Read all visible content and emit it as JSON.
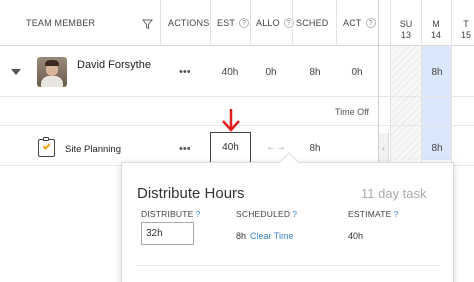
{
  "header": {
    "team_member": "TEAM MEMBER",
    "actions": "ACTIONS",
    "est": "EST",
    "allo": "ALLO",
    "sched": "SCHED",
    "act": "ACT",
    "help_glyph": "?",
    "days": [
      {
        "dow": "SU",
        "date": "13"
      },
      {
        "dow": "M",
        "date": "14"
      },
      {
        "dow": "T",
        "date": "15"
      }
    ]
  },
  "member": {
    "name": "David Forsythe",
    "actions": "•••",
    "est": "40h",
    "allo": "0h",
    "sched": "8h",
    "act": "0h",
    "today_value": "8h"
  },
  "time_off_label": "Time Off",
  "task": {
    "name": "Site Planning",
    "actions": "•••",
    "est": "40h",
    "sched": "8h",
    "today_value": "8h",
    "swap_glyph": "←→",
    "left_chevron": "‹"
  },
  "popover": {
    "title": "Distribute Hours",
    "subtitle": "11 day task",
    "distribute_label": "DISTRIBUTE",
    "scheduled_label": "SCHEDULED",
    "estimate_label": "ESTIMATE",
    "help_glyph": "?",
    "distribute_value": "32h",
    "scheduled_value": "8h",
    "clear_time": "Clear Time",
    "estimate_value": "40h"
  },
  "colors": {
    "accent_blue": "#3b82d6",
    "arrow_red": "#e02020",
    "today_bg": "#dbe7fb",
    "task_check": "#f39c12"
  },
  "icons": [
    "filter-icon",
    "help-icon",
    "caret-down-icon",
    "task-icon",
    "arrow-down-icon",
    "swap-icon",
    "chevron-left-icon"
  ]
}
